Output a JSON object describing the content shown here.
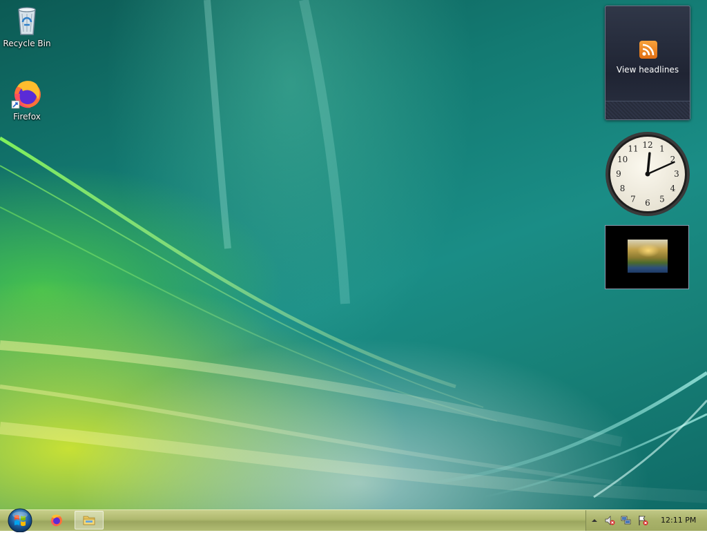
{
  "desktop": {
    "icons": [
      {
        "label": "Recycle Bin",
        "icon": "recycle-bin-icon"
      },
      {
        "label": "Firefox",
        "icon": "firefox-icon"
      }
    ]
  },
  "gadgets": {
    "feed": {
      "label": "View headlines",
      "icon": "rss-icon"
    },
    "clock": {
      "numerals": [
        "12",
        "1",
        "2",
        "3",
        "4",
        "5",
        "6",
        "7",
        "8",
        "9",
        "10",
        "11"
      ],
      "hour": 12,
      "minute": 11
    },
    "slideshow": {
      "icon": "slideshow-photo"
    }
  },
  "taskbar": {
    "start_icon": "windows-start-orb",
    "items": [
      {
        "name": "firefox",
        "icon": "firefox-icon"
      },
      {
        "name": "windows-explorer",
        "icon": "folder-icon"
      }
    ],
    "tray": {
      "icons": [
        "show-hidden-icons-arrow",
        "volume-muted-icon",
        "network-icon",
        "action-center-alert-icon"
      ],
      "time": "12:11 PM"
    }
  },
  "colors": {
    "rss_orange": "#f08a24",
    "taskbar": "#aeb86e",
    "wallpaper_teal": "#1a8d86",
    "wallpaper_green": "#7ee04a"
  }
}
